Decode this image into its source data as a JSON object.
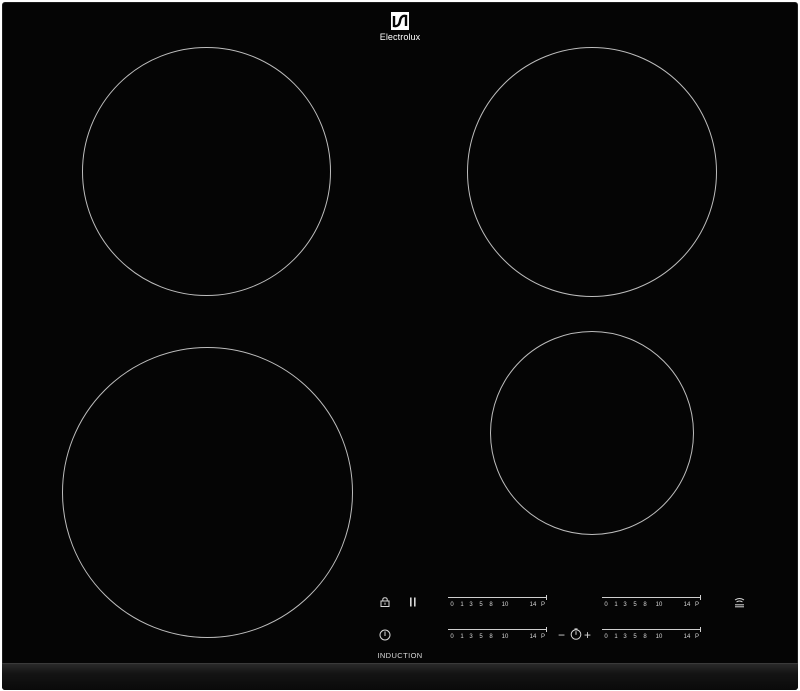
{
  "brand": {
    "name": "Electrolux"
  },
  "controls": {
    "lock_icon": "lock-icon",
    "pause_icon": "pause-icon",
    "power_icon": "power-icon",
    "bridge_icon": "bridge-icon",
    "timer_minus": "−",
    "timer_plus": "+",
    "footer_label": "INDUCTION"
  },
  "sliders": [
    {
      "id": "top-left",
      "labels": [
        "0",
        "1",
        "3",
        "5",
        "8",
        "10",
        "14",
        "P"
      ]
    },
    {
      "id": "top-right",
      "labels": [
        "0",
        "1",
        "3",
        "5",
        "8",
        "10",
        "14",
        "P"
      ]
    },
    {
      "id": "bottom-left",
      "labels": [
        "0",
        "1",
        "3",
        "5",
        "8",
        "10",
        "14",
        "P"
      ]
    },
    {
      "id": "bottom-right",
      "labels": [
        "0",
        "1",
        "3",
        "5",
        "8",
        "10",
        "14",
        "P"
      ]
    }
  ],
  "colors": {
    "glass": "#050505",
    "markings": "#d8d8d8"
  }
}
